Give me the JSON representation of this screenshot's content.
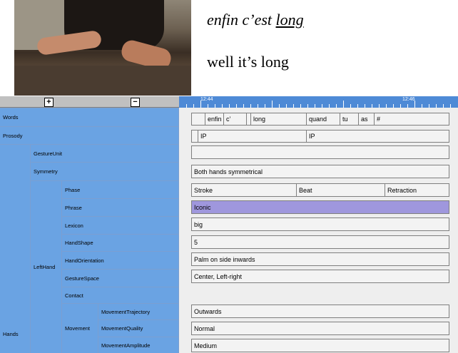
{
  "video": {
    "alt": "signer video frame"
  },
  "transcript": {
    "french_prefix": "enfin c’est ",
    "french_underlined": "long",
    "english": "well it’s long"
  },
  "zoom": {
    "plus": "+",
    "minus": "−"
  },
  "timeline": {
    "start_label": "12:44",
    "end_label": "12:46"
  },
  "tiers": {
    "words": "Words",
    "prosody": "Prosody",
    "hands": "Hands",
    "gesture_unit": "GestureUnit",
    "symmetry": "Symmetry",
    "left_hand": "LeftHand",
    "phase": "Phase",
    "phrase": "Phrase",
    "lexicon": "Lexicon",
    "hand_shape": "HandShape",
    "hand_orientation": "HandOrientation",
    "gesture_space": "GestureSpace",
    "contact": "Contact",
    "movement": "Movement",
    "movement_trajectory": "MovementTrajectory",
    "movement_quality": "MovementQuality",
    "movement_amplitude": "MovementAmplitude"
  },
  "annotations": {
    "words": [
      "enfin",
      "c’",
      "long",
      "quand",
      "tu",
      "as",
      "#"
    ],
    "prosody": [
      "IP",
      "IP"
    ],
    "symmetry": "Both hands symmetrical",
    "phase": [
      "Stroke",
      "Beat",
      "Retraction"
    ],
    "phrase": "Iconic",
    "lexicon": "big",
    "hand_shape": "5",
    "hand_orientation": "Palm on side inwards",
    "gesture_space": "Center, Left-right",
    "movement_trajectory": "Outwards",
    "movement_quality": "Normal",
    "movement_amplitude": "Medium"
  },
  "colors": {
    "tier_label_bg": "#6aa3e3",
    "timeline_bar": "#4e8ad6",
    "selected_phrase": "#9f97dd"
  }
}
